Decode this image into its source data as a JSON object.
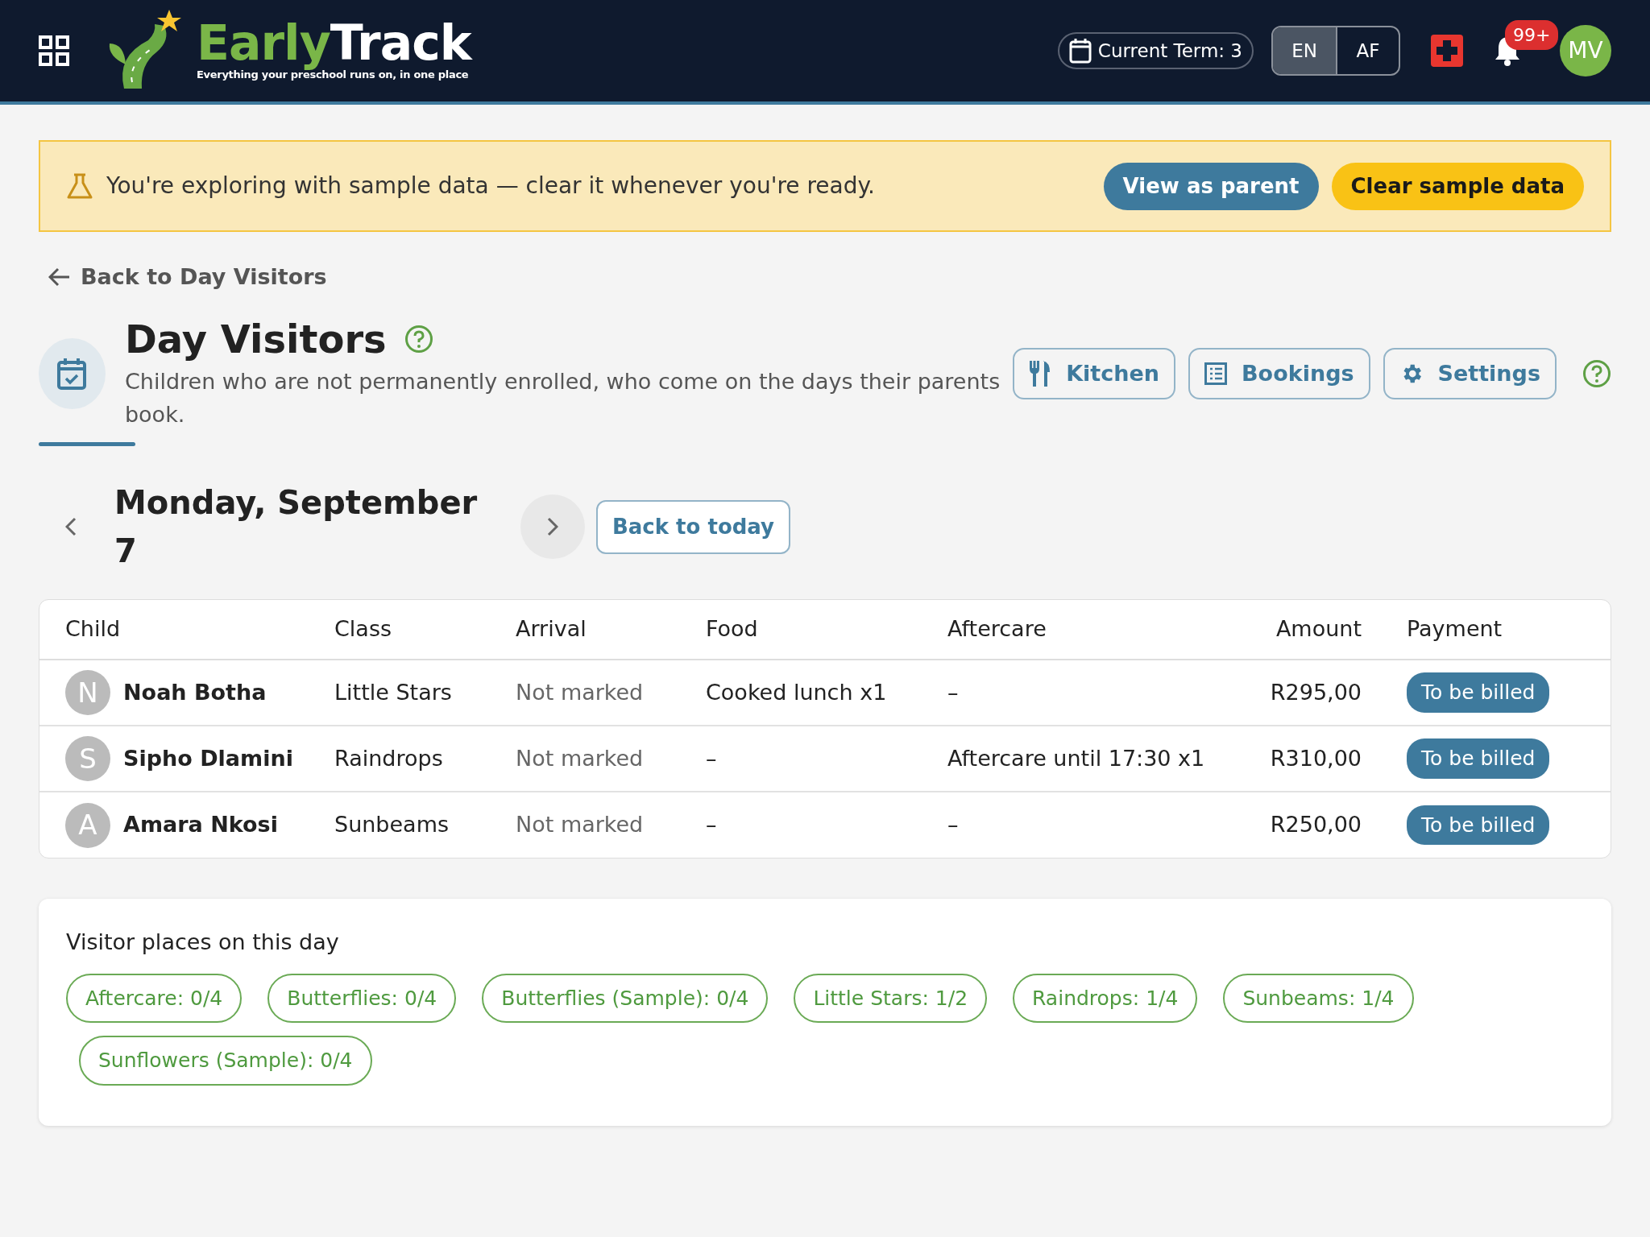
{
  "header": {
    "brand": "EarlyTrack",
    "tagline": "Everything your preschool runs on, in one place",
    "term": "Current Term: 3",
    "languages": [
      {
        "label": "EN",
        "selected": true
      },
      {
        "label": "AF",
        "selected": false
      }
    ],
    "notifications": "99+",
    "avatar": "MV"
  },
  "banner": {
    "message": "You're exploring with sample data — clear it whenever you're ready.",
    "buttons": [
      {
        "label": "View as parent",
        "kind": "secondary"
      },
      {
        "label": "Clear sample data",
        "kind": "warning"
      }
    ]
  },
  "back_link": "Back to Day Visitors",
  "page": {
    "title": "Day Visitors",
    "subtitle": "Children who are not permanently enrolled, who come on the days their parents book.",
    "actions": [
      {
        "label": "Kitchen",
        "kind": "kitchen"
      },
      {
        "label": "Bookings",
        "kind": "list"
      },
      {
        "label": "Settings",
        "kind": "gear"
      }
    ]
  },
  "date_nav": {
    "date": "Monday, September 7",
    "today_button": "Back to today"
  },
  "table": {
    "columns": [
      "Child",
      "Class",
      "Arrival",
      "Food",
      "Aftercare",
      "Amount",
      "Payment"
    ],
    "rows": [
      {
        "initial": "N",
        "child": "Noah Botha",
        "class": "Little Stars",
        "arrival": "Not marked",
        "food": "Cooked lunch x1",
        "aftercare": "–",
        "amount": "R295,00",
        "payment": "To be billed"
      },
      {
        "initial": "S",
        "child": "Sipho Dlamini",
        "class": "Raindrops",
        "arrival": "Not marked",
        "food": "–",
        "aftercare": "Aftercare until 17:30 x1",
        "amount": "R310,00",
        "payment": "To be billed"
      },
      {
        "initial": "A",
        "child": "Amara Nkosi",
        "class": "Sunbeams",
        "arrival": "Not marked",
        "food": "–",
        "aftercare": "–",
        "amount": "R250,00",
        "payment": "To be billed"
      }
    ]
  },
  "places": {
    "title": "Visitor places on this day",
    "chips": [
      "Aftercare: 0/4",
      "Butterflies: 0/4",
      "Butterflies (Sample): 0/4",
      "Little Stars: 1/2",
      "Raindrops: 1/4",
      "Sunbeams: 1/4",
      "Sunflowers (Sample): 0/4"
    ]
  }
}
